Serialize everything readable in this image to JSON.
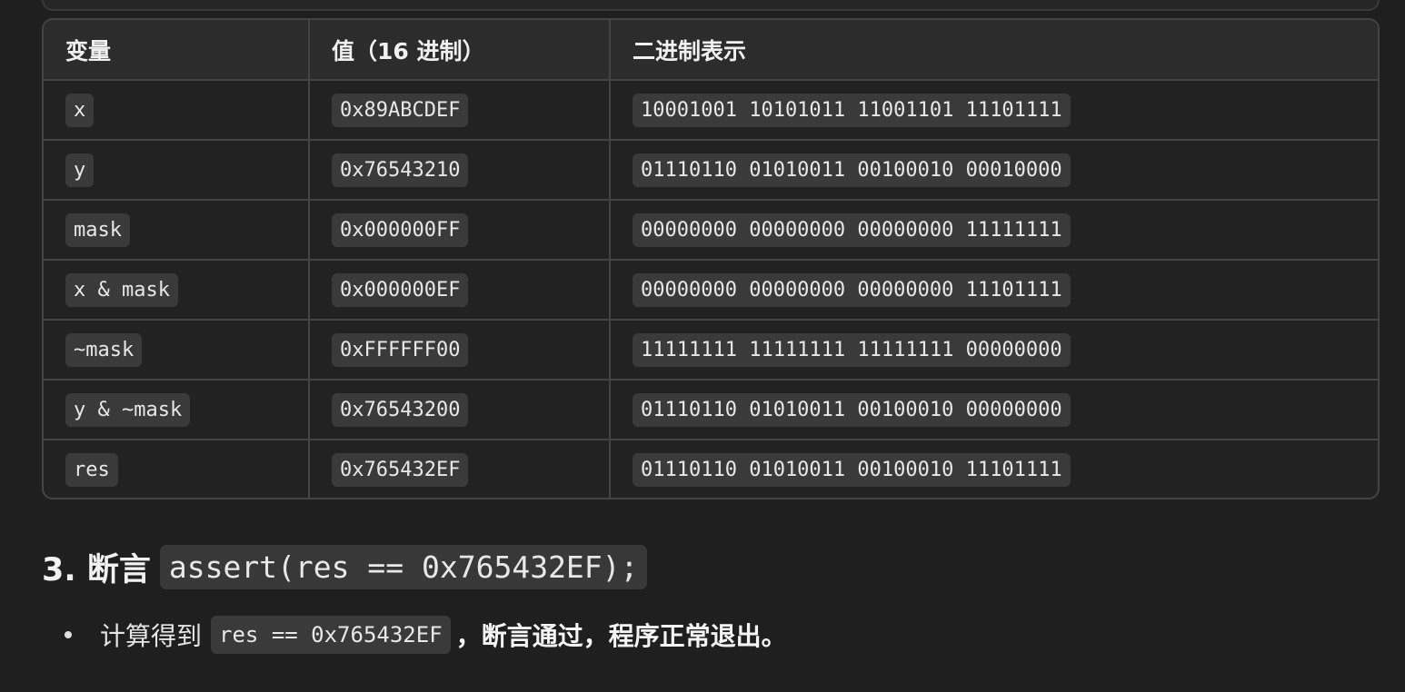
{
  "table": {
    "headers": [
      "变量",
      "值（16 进制）",
      "二进制表示"
    ],
    "rows": [
      {
        "variable": "x",
        "hex": "0x89ABCDEF",
        "binary": "10001001 10101011 11001101 11101111"
      },
      {
        "variable": "y",
        "hex": "0x76543210",
        "binary": "01110110 01010011 00100010 00010000"
      },
      {
        "variable": "mask",
        "hex": "0x000000FF",
        "binary": "00000000 00000000 00000000 11111111"
      },
      {
        "variable": "x & mask",
        "hex": "0x000000EF",
        "binary": "00000000 00000000 00000000 11101111"
      },
      {
        "variable": "~mask",
        "hex": "0xFFFFFF00",
        "binary": "11111111 11111111 11111111 00000000"
      },
      {
        "variable": "y & ~mask",
        "hex": "0x76543200",
        "binary": "01110110 01010011 00100010 00000000"
      },
      {
        "variable": "res",
        "hex": "0x765432EF",
        "binary": "01110110 01010011 00100010 11101111"
      }
    ]
  },
  "section": {
    "heading_prefix": "3. 断言",
    "heading_code": "assert(res == 0x765432EF);",
    "bullet": {
      "prefix": "计算得到",
      "code": "res == 0x765432EF",
      "suffix": "，断言通过，程序正常退出。"
    }
  }
}
